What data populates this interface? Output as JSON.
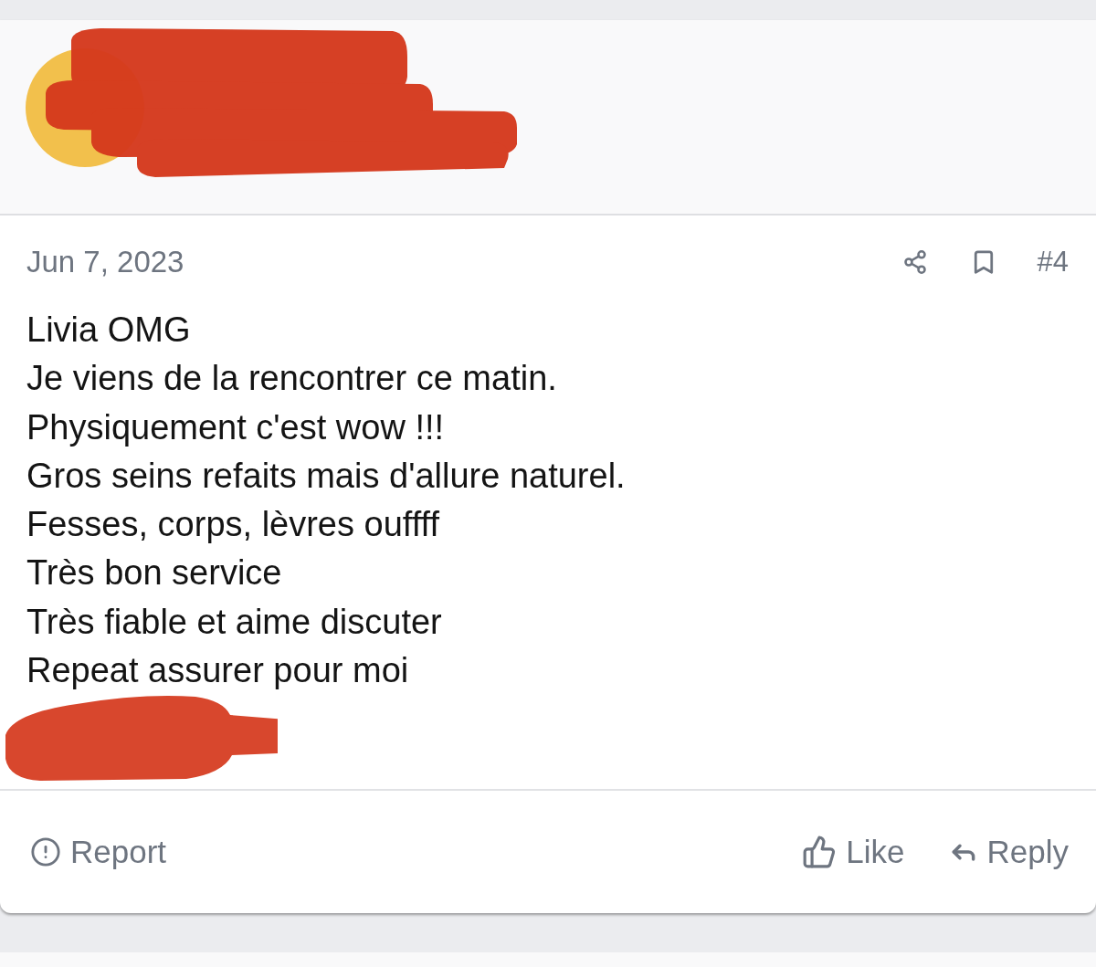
{
  "post": {
    "date": "Jun 7, 2023",
    "number": "#4",
    "body_lines": [
      "Livia OMG",
      "Je viens de la rencontrer ce matin.",
      "Physiquement c'est wow !!!",
      "Gros seins refaits mais d'allure naturel.",
      "Fesses, corps, lèvres ouffff",
      "Très bon service",
      "Très fiable et aime discuter",
      "Repeat assurer pour moi"
    ]
  },
  "footer": {
    "report": "Report",
    "like": "Like",
    "reply": "Reply"
  }
}
